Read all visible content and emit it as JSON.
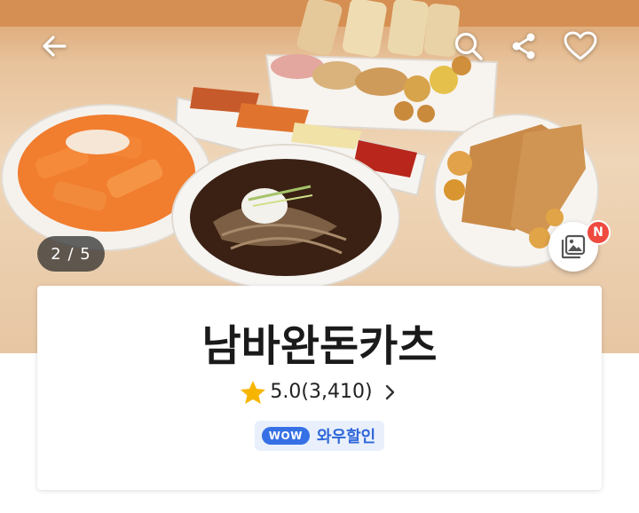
{
  "header": {
    "back_icon": "arrow-left-icon",
    "search_icon": "search-icon",
    "share_icon": "share-icon",
    "favorite_icon": "heart-outline-icon"
  },
  "gallery": {
    "counter": "2 / 5",
    "current": 2,
    "total": 5,
    "new_badge": "N",
    "button_icon": "photo-gallery-icon"
  },
  "store": {
    "name": "남바완돈카츠",
    "rating": "5.0(3,410)",
    "rating_icon": "star-icon",
    "promo_pill": "WOW",
    "promo_label": "와우할인"
  },
  "colors": {
    "star": "#f7b500",
    "wow_blue": "#3670e6",
    "badge_red": "#ef4a3f"
  }
}
